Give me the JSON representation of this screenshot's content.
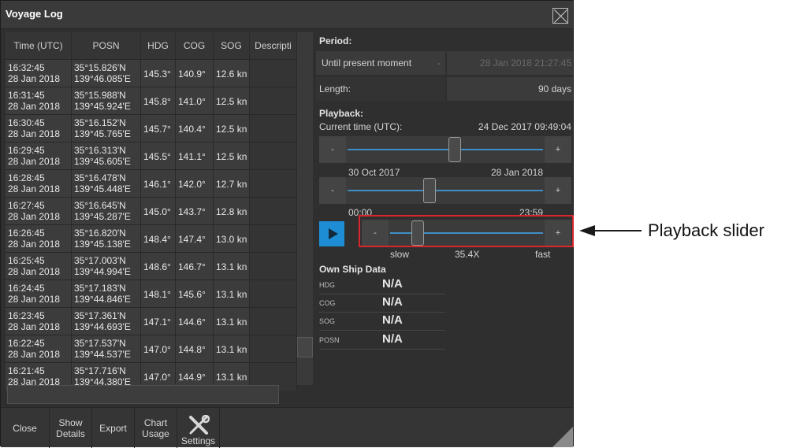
{
  "window": {
    "title": "Voyage Log"
  },
  "table": {
    "columns": [
      "Time (UTC)",
      "POSN",
      "HDG",
      "COG",
      "SOG",
      "Descripti"
    ],
    "rows": [
      {
        "time": "16:32:45",
        "date": "28 Jan 2018",
        "lat": "35°15.826'N",
        "lon": "139°46.085'E",
        "hdg": "145.3°",
        "cog": "140.9°",
        "sog": "12.6 kn"
      },
      {
        "time": "16:31:45",
        "date": "28 Jan 2018",
        "lat": "35°15.988'N",
        "lon": "139°45.924'E",
        "hdg": "145.8°",
        "cog": "141.0°",
        "sog": "12.5 kn"
      },
      {
        "time": "16:30:45",
        "date": "28 Jan 2018",
        "lat": "35°16.152'N",
        "lon": "139°45.765'E",
        "hdg": "145.7°",
        "cog": "140.4°",
        "sog": "12.5 kn"
      },
      {
        "time": "16:29:45",
        "date": "28 Jan 2018",
        "lat": "35°16.313'N",
        "lon": "139°45.605'E",
        "hdg": "145.5°",
        "cog": "141.1°",
        "sog": "12.5 kn"
      },
      {
        "time": "16:28:45",
        "date": "28 Jan 2018",
        "lat": "35°16.478'N",
        "lon": "139°45.448'E",
        "hdg": "146.1°",
        "cog": "142.0°",
        "sog": "12.7 kn"
      },
      {
        "time": "16:27:45",
        "date": "28 Jan 2018",
        "lat": "35°16.645'N",
        "lon": "139°45.287'E",
        "hdg": "145.0°",
        "cog": "143.7°",
        "sog": "12.8 kn"
      },
      {
        "time": "16:26:45",
        "date": "28 Jan 2018",
        "lat": "35°16.820'N",
        "lon": "139°45.138'E",
        "hdg": "148.4°",
        "cog": "147.4°",
        "sog": "13.0 kn"
      },
      {
        "time": "16:25:45",
        "date": "28 Jan 2018",
        "lat": "35°17.003'N",
        "lon": "139°44.994'E",
        "hdg": "148.6°",
        "cog": "146.7°",
        "sog": "13.1 kn"
      },
      {
        "time": "16:24:45",
        "date": "28 Jan 2018",
        "lat": "35°17.183'N",
        "lon": "139°44.846'E",
        "hdg": "148.1°",
        "cog": "145.6°",
        "sog": "13.1 kn"
      },
      {
        "time": "16:23:45",
        "date": "28 Jan 2018",
        "lat": "35°17.361'N",
        "lon": "139°44.693'E",
        "hdg": "147.1°",
        "cog": "144.6°",
        "sog": "13.1 kn"
      },
      {
        "time": "16:22:45",
        "date": "28 Jan 2018",
        "lat": "35°17.537'N",
        "lon": "139°44.537'E",
        "hdg": "147.0°",
        "cog": "144.8°",
        "sog": "13.1 kn"
      },
      {
        "time": "16:21:45",
        "date": "28 Jan 2018",
        "lat": "35°17.716'N",
        "lon": "139°44.380'E",
        "hdg": "147.0°",
        "cog": "144.9°",
        "sog": "13.1 kn"
      }
    ]
  },
  "toolbar": {
    "close": "Close",
    "show_details": "Show Details",
    "export": "Export",
    "chart_usage": "Chart Usage",
    "settings": "Settings"
  },
  "period": {
    "heading": "Period:",
    "mode": "Until present moment",
    "mode_arrow": "-",
    "end_time": "28 Jan 2018 21:27:45",
    "length_label": "Length:",
    "length_value": "90 days"
  },
  "playback": {
    "heading": "Playback:",
    "current_label": "Current time (UTC):",
    "current_value": "24 Dec 2017 09:49:04",
    "date_slider": {
      "min_label": "30 Oct 2017",
      "max_label": "28 Jan 2018",
      "position": 0.55,
      "minus": "-",
      "plus": "+"
    },
    "time_slider": {
      "min_label": "00:00",
      "max_label": "23:59",
      "position": 0.42,
      "minus": "-",
      "plus": "+"
    },
    "speed_slider": {
      "slow_label": "slow",
      "value_label": "35.4X",
      "fast_label": "fast",
      "position": 0.18,
      "minus": "-",
      "plus": "+"
    }
  },
  "own_ship": {
    "heading": "Own Ship Data",
    "fields": [
      {
        "label": "HDG",
        "value": "N/A"
      },
      {
        "label": "COG",
        "value": "N/A"
      },
      {
        "label": "SOG",
        "value": "N/A"
      },
      {
        "label": "POSN",
        "value": "N/A"
      }
    ]
  },
  "callout": {
    "text": "Playback slider",
    "highlight_color": "#d9262e"
  },
  "colors": {
    "accent": "#1d8ed6",
    "slider_track": "#3f8fc4"
  }
}
